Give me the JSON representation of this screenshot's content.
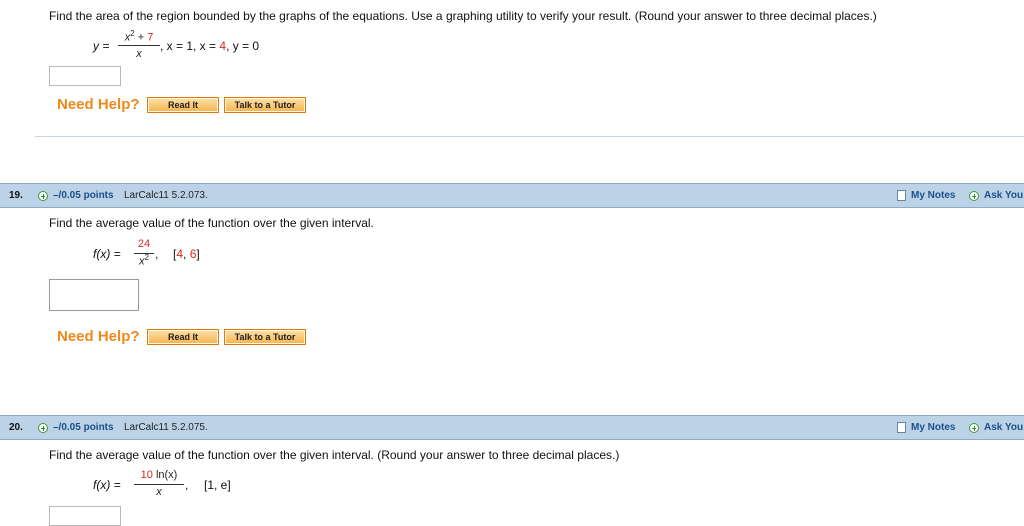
{
  "q18": {
    "prompt": "Find the area of the region bounded by the graphs of the equations. Use a graphing utility to verify your result. (Round your answer to three decimal places.)",
    "eq_lhs": "y =",
    "eq_num_x": "x",
    "eq_num_sup": "2",
    "eq_num_plus": " + ",
    "eq_num_const": "7",
    "eq_den": "x",
    "eq_rest1": ", x = 1, x = ",
    "eq_rest_red": "4",
    "eq_rest2": ", y = 0",
    "need_help": "Need Help?",
    "read_it": "Read It",
    "talk_tutor": "Talk to a Tutor"
  },
  "q19": {
    "number": "19.",
    "points": "–/0.05 points",
    "ref": "LarCalc11 5.2.073.",
    "my_notes": "My Notes",
    "ask": "Ask You",
    "prompt": "Find the average value of the function over the given interval.",
    "f_lhs": "f(x) =",
    "f_num": "24",
    "f_den_x": "x",
    "f_den_sup": "2",
    "f_comma": ",",
    "interval_open": "[",
    "interval_a": "4",
    "interval_sep": ", ",
    "interval_b": "6",
    "interval_close": "]",
    "need_help": "Need Help?",
    "read_it": "Read It",
    "talk_tutor": "Talk to a Tutor"
  },
  "q20": {
    "number": "20.",
    "points": "–/0.05 points",
    "ref": "LarCalc11 5.2.075.",
    "my_notes": "My Notes",
    "ask": "Ask You",
    "prompt": "Find the average value of the function over the given interval. (Round your answer to three decimal places.)",
    "f_lhs": "f(x) =",
    "f_num_red": "10",
    "f_num_rest": " ln(x)",
    "f_den": "x",
    "f_comma": ",",
    "interval": "[1, e]"
  }
}
